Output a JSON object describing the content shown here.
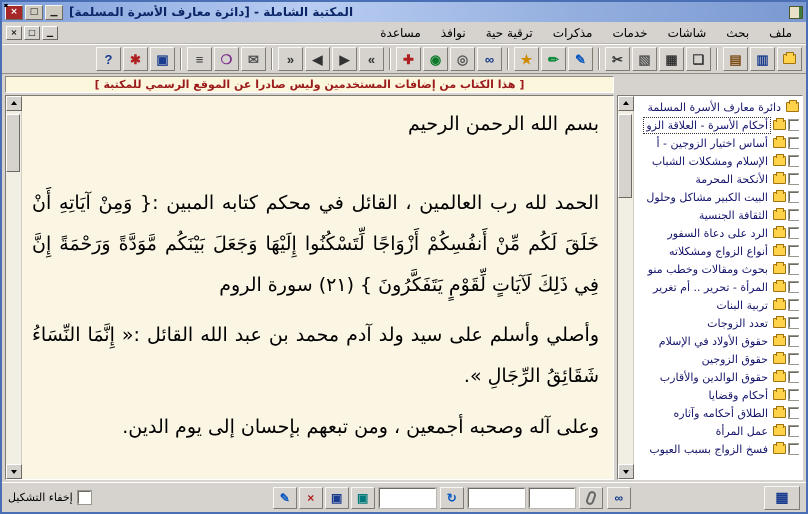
{
  "window": {
    "title": "المكتبة الشاملة - [دائرة معارف الأسرة المسلمة]"
  },
  "icons": {
    "close": "×",
    "maximize": "□",
    "minimize": "▁",
    "mdi_close": "×",
    "mdi_restore": "□",
    "mdi_minimize": "▁",
    "pencil": "✎",
    "delete": "×",
    "save": "▣",
    "export": "▣",
    "refresh": "↻",
    "binoculars": "∞",
    "grid": "▦"
  },
  "menu": {
    "items": [
      "ملف",
      "بحث",
      "شاشات",
      "خدمات",
      "مذكرات",
      "ترقية حية",
      "نوافذ",
      "مساعدة"
    ]
  },
  "toolbar": {
    "buttons": [
      {
        "name": "open-folder",
        "glyph": ""
      },
      {
        "name": "library",
        "glyph": "▥"
      },
      {
        "name": "book",
        "glyph": "▤"
      },
      {
        "name": "new-doc",
        "glyph": "❏"
      },
      {
        "name": "print",
        "glyph": "▦"
      },
      {
        "name": "copy",
        "glyph": "▧"
      },
      {
        "name": "cut",
        "glyph": "✂"
      },
      {
        "name": "pencil",
        "glyph": "✎"
      },
      {
        "name": "marker",
        "glyph": "✏"
      },
      {
        "name": "bookmark",
        "glyph": "★"
      },
      {
        "name": "binoculars",
        "glyph": "∞"
      },
      {
        "name": "search-scope",
        "glyph": "◎"
      },
      {
        "name": "globe",
        "glyph": "◉"
      },
      {
        "name": "services",
        "glyph": "✚"
      },
      {
        "name": "nav-first",
        "glyph": "»"
      },
      {
        "name": "nav-prev",
        "glyph": "▶"
      },
      {
        "name": "nav-next",
        "glyph": "◀"
      },
      {
        "name": "nav-last",
        "glyph": "«"
      },
      {
        "name": "envelope",
        "glyph": "✉"
      },
      {
        "name": "notes",
        "glyph": "❍"
      },
      {
        "name": "list",
        "glyph": "≡"
      },
      {
        "name": "save",
        "glyph": "▣"
      },
      {
        "name": "settings",
        "glyph": "✱"
      },
      {
        "name": "help",
        "glyph": "?"
      }
    ]
  },
  "notice": {
    "text": "[ هذا الكتاب من إضافات المستخدمين وليس صادرا عن الموقع الرسمي للمكتبة ]"
  },
  "reader": {
    "paragraphs": [
      "بسم الله الرحمن الرحيم",
      "الحمد لله رب العالمين ، القائل في محكم كتابه المبين :{ وَمِنْ آيَاتِهِ أَنْ خَلَقَ لَكُم مِّنْ أَنفُسِكُمْ أَزْوَاجًا لِّتَسْكُنُوا إِلَيْهَا وَجَعَلَ بَيْنَكُم مَّوَدَّةً وَرَحْمَةً إِنَّ فِي ذَلِكَ لَآيَاتٍ لِّقَوْمٍ يَتَفَكَّرُونَ } (٢١) سورة الروم",
      "وأصلي وأسلم على سيد ولد آدم محمد بن عبد الله القائل :« إِنَّمَا النِّسَاءُ شَقَائِقُ الرِّجَالِ ».",
      "وعلى آله وصحبه أجمعين ، ومن تبعهم بإحسان إلى يوم الدين."
    ]
  },
  "tree": {
    "root": "دائرة معارف الأسرة المسلمة",
    "selected_index": 0,
    "items": [
      "أحكام الأسرة - العلاقة الزو",
      "أساس اختيار الزوجين - أ",
      "الإسلام ومشكلات الشباب",
      "الأنكحة المحرمة",
      "البيت الكبير مشاكل وحلول",
      "الثقافة الجنسية",
      "الرد على دعاة السفور",
      "أنواع الزواج ومشكلاته",
      "بحوث ومقالات وخطب منو",
      "المرأة - تحرير .. أم تغرير",
      "تربية البنات",
      "تعدد الزوجات",
      "حقوق الأولاد في الإسلام",
      "حقوق الزوجين",
      "حقوق الوالدين والأقارب",
      "أحكام وقضايا",
      "الطلاق أحكامه وآثاره",
      "عمل المرأة",
      "فسخ الزواج بسبب العيوب"
    ]
  },
  "statusbar": {
    "hide_tashkeel_label": "إخفاء التشكيل"
  },
  "colors": {
    "titlebar_blue": "#8fadde",
    "reader_background": "#fbf6e3",
    "notice_text": "#9b1a1a",
    "folder_yellow": "#ffd24a",
    "chrome_gray": "#d6d3ce"
  }
}
